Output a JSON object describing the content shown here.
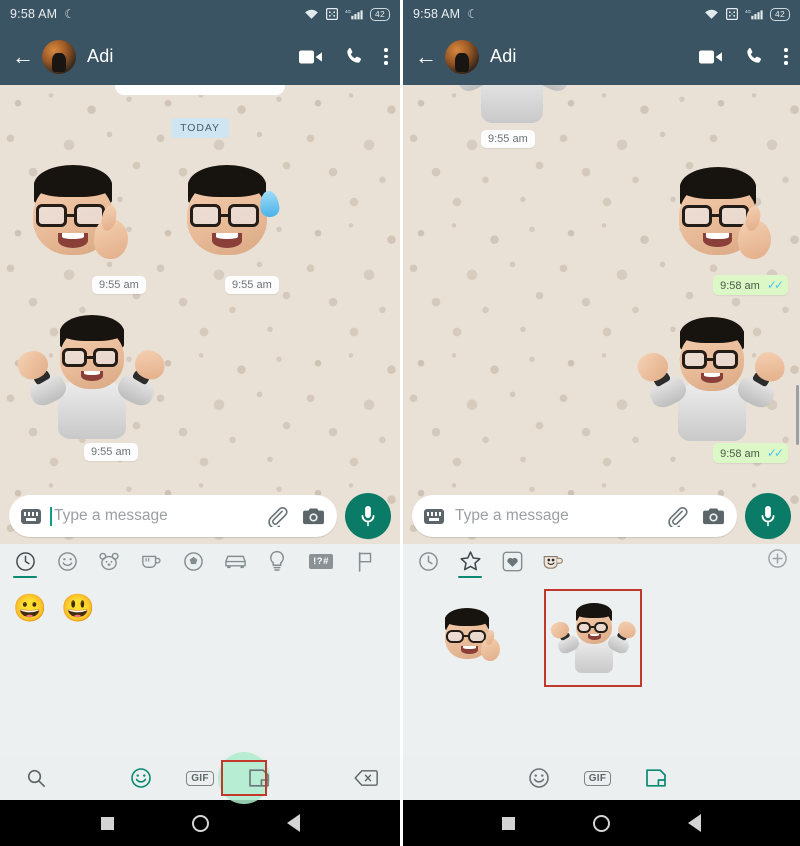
{
  "screens": [
    {
      "id": "left",
      "status_bar": {
        "time": "9:58 AM",
        "moon_icon": "crescent-moon-icon",
        "wifi_icon": "wifi-icon",
        "vpn_icon": "vpn-key-icon",
        "signal_icon": "signal-4g-icon",
        "network_label": "4G",
        "battery_level": "42"
      },
      "header": {
        "back_icon": "back-arrow-icon",
        "avatar": "contact-avatar",
        "contact_name": "Adi",
        "video_call_icon": "video-call-icon",
        "voice_call_icon": "phone-call-icon",
        "menu_icon": "more-options-icon"
      },
      "chat": {
        "day_divider": "TODAY",
        "messages": [
          {
            "id": "m1",
            "kind": "sticker",
            "sticker": "memoji-thumbs-up",
            "direction": "in",
            "time": "9:55 am",
            "status": ""
          },
          {
            "id": "m2",
            "kind": "sticker",
            "sticker": "memoji-sweat-smile",
            "direction": "in",
            "time": "9:55 am",
            "status": ""
          },
          {
            "id": "m3",
            "kind": "sticker",
            "sticker": "memoji-shrug",
            "direction": "in",
            "time": "9:55 am",
            "status": ""
          }
        ]
      },
      "composer": {
        "keyboard_icon": "keyboard-icon",
        "placeholder": "Type a message",
        "value": "",
        "attach_icon": "attach-paperclip-icon",
        "camera_icon": "camera-icon",
        "mic_icon": "microphone-icon"
      },
      "panel": {
        "mode": "emoji",
        "tabs": [
          {
            "name": "recent",
            "icon": "clock-icon",
            "glyph": "",
            "active": true
          },
          {
            "name": "smileys",
            "icon": "smiley-face-icon",
            "glyph": "",
            "active": false
          },
          {
            "name": "animals",
            "icon": "bear-face-icon",
            "glyph": "",
            "active": false
          },
          {
            "name": "food",
            "icon": "coffee-cup-icon",
            "glyph": "",
            "active": false
          },
          {
            "name": "activities",
            "icon": "soccer-ball-icon",
            "glyph": "",
            "active": false
          },
          {
            "name": "travel",
            "icon": "car-icon",
            "glyph": "",
            "active": false
          },
          {
            "name": "objects",
            "icon": "light-bulb-icon",
            "glyph": "",
            "active": false
          },
          {
            "name": "symbols",
            "icon": "symbols-icon",
            "glyph": "!?#",
            "active": false
          },
          {
            "name": "flags",
            "icon": "flag-icon",
            "glyph": "",
            "active": false
          }
        ],
        "emojis": [
          "grinning-face",
          "grinning-face"
        ]
      },
      "keyboard_bar": {
        "search_icon": "search-icon",
        "emoji_icon": "emoji-icon",
        "gif_label": "GIF",
        "sticker_icon": "sticker-icon",
        "backspace_icon": "backspace-icon",
        "highlight_target": "sticker-icon",
        "highlight_color": "#c0392b"
      },
      "nav_bar": {
        "recents_icon": "recents-square-icon",
        "home_icon": "home-circle-icon",
        "back_icon": "back-triangle-icon"
      }
    },
    {
      "id": "right",
      "status_bar": {
        "time": "9:58 AM",
        "moon_icon": "crescent-moon-icon",
        "wifi_icon": "wifi-icon",
        "vpn_icon": "vpn-key-icon",
        "signal_icon": "signal-4g-icon",
        "network_label": "4G",
        "battery_level": "42"
      },
      "header": {
        "back_icon": "back-arrow-icon",
        "avatar": "contact-avatar",
        "contact_name": "Adi",
        "video_call_icon": "video-call-icon",
        "voice_call_icon": "phone-call-icon",
        "menu_icon": "more-options-icon"
      },
      "chat": {
        "day_divider": "",
        "messages": [
          {
            "id": "r0",
            "kind": "sticker",
            "sticker": "memoji-shrug-partial",
            "direction": "in",
            "time": "9:55 am",
            "status": ""
          },
          {
            "id": "r1",
            "kind": "sticker",
            "sticker": "memoji-thumbs-up",
            "direction": "out",
            "time": "9:58 am",
            "status": "read"
          },
          {
            "id": "r2",
            "kind": "sticker",
            "sticker": "memoji-shrug",
            "direction": "out",
            "time": "9:58 am",
            "status": "read"
          }
        ]
      },
      "composer": {
        "keyboard_icon": "keyboard-icon",
        "placeholder": "Type a message",
        "value": "",
        "attach_icon": "attach-paperclip-icon",
        "camera_icon": "camera-icon",
        "mic_icon": "microphone-icon"
      },
      "panel": {
        "mode": "sticker",
        "tabs": [
          {
            "name": "recent",
            "icon": "clock-icon",
            "glyph": "",
            "active": false
          },
          {
            "name": "favourites",
            "icon": "star-icon",
            "glyph": "",
            "active": true
          },
          {
            "name": "hearts-pack",
            "icon": "heart-square-icon",
            "glyph": "",
            "active": false
          },
          {
            "name": "cup-pack",
            "icon": "cup-sticker-icon",
            "glyph": "",
            "active": false
          }
        ],
        "add_pack_icon": "add-plus-icon",
        "stickers": [
          {
            "name": "memoji-thumbs-up",
            "selected": false
          },
          {
            "name": "memoji-shrug",
            "selected": true
          }
        ],
        "selection_color": "#c0392b"
      },
      "keyboard_bar": {
        "search_icon": "",
        "emoji_icon": "emoji-icon",
        "gif_label": "GIF",
        "sticker_icon": "sticker-icon",
        "backspace_icon": "",
        "highlight_target": "",
        "active_tool": "sticker-icon",
        "active_color": "#0a8a72"
      },
      "nav_bar": {
        "recents_icon": "recents-square-icon",
        "home_icon": "home-circle-icon",
        "back_icon": "back-triangle-icon"
      }
    }
  ],
  "theme": {
    "header_bg": "#3b5463",
    "chat_bg": "#e9e0d6",
    "panel_bg": "#edf0f1",
    "accent_green": "#0a8a72",
    "mic_green": "#0a7b66",
    "outgoing_bubble": "#dcf8c6",
    "incoming_bubble": "#fcfcfc",
    "day_badge_bg": "#cfe6f2",
    "tick_blue": "#4fc3f7",
    "highlight_red": "#c0392b",
    "highlight_green": "#aeeccd"
  }
}
